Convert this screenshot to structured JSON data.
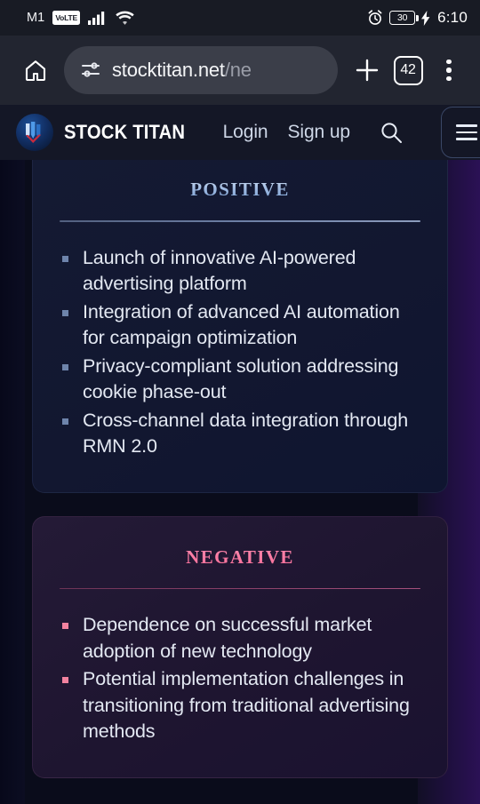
{
  "statusbar": {
    "carrier": "M1",
    "volte": "VoLTE",
    "signal_icon": "signal-bars-icon",
    "wifi_icon": "wifi-icon",
    "alarm_icon": "alarm-clock-icon",
    "battery_level": "30",
    "charging_icon": "charging-bolt-icon",
    "time": "6:10"
  },
  "browser": {
    "home_icon": "home-icon",
    "site_settings_icon": "tune-sliders-icon",
    "url_visible": "stocktitan.net",
    "url_dim": "/ne",
    "new_tab_icon": "plus-icon",
    "tab_count": "42",
    "menu_icon": "three-dot-menu-icon"
  },
  "site_header": {
    "logo_icon": "stock-titan-logo-icon",
    "brand": "STOCK TITAN",
    "login_label": "Login",
    "signup_label": "Sign up",
    "search_icon": "search-icon",
    "hamburger_icon": "hamburger-menu-icon"
  },
  "main": {
    "positive": {
      "title": "Positive",
      "bullets": [
        "Launch of innovative AI-powered advertising platform",
        "Integration of advanced AI automation for campaign optimization",
        "Privacy-compliant solution addressing cookie phase-out",
        "Cross-channel data integration through RMN 2.0"
      ]
    },
    "negative": {
      "title": "Negative",
      "bullets": [
        "Dependence on successful market adoption of new technology",
        "Potential implementation challenges in transitioning from traditional advertising methods"
      ]
    }
  },
  "colors": {
    "status_bar_bg": "#181b24",
    "browser_bar_bg": "#222530",
    "page_bg": "#0a0c1b",
    "positive_accent": "#9db9e2",
    "negative_accent": "#ff7ba3",
    "brand_blue": "#1d4f96"
  }
}
